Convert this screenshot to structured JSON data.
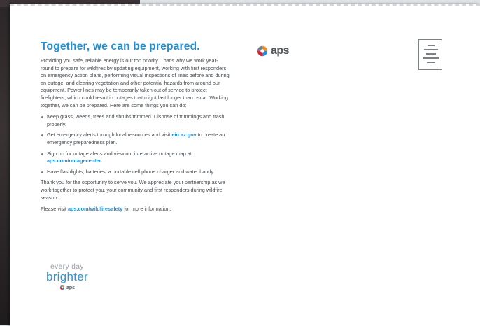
{
  "headline": "Together, we can be prepared.",
  "intro": "Providing you safe, reliable energy is our top priority. That's why we work year-round to prepare for wildfires by updating equipment, working with first responders on emergency action plans, performing visual inspections of lines before and during an outage, and clearing vegetation and other potential hazards from around our equipment. Power lines may be temporarily taken out of service to protect firefighters, which could result in outages that might last longer than usual. Working together, we can be prepared. Here are some things you can do:",
  "bullets": [
    {
      "text": "Keep grass, weeds, trees and shrubs trimmed. Dispose of trimmings and trash properly."
    },
    {
      "before": "Get emergency alerts through local resources and visit ",
      "link": "ein.az.gov",
      "after": " to create an emergency preparedness plan."
    },
    {
      "before": "Sign up for outage alerts and view our interactive outage map at ",
      "link": "aps.com/outagecenter",
      "after": "."
    },
    {
      "text": "Have flashlights, batteries, a portable cell phone charger and water handy."
    }
  ],
  "thanks": "Thank you for the opportunity to serve you. We appreciate your partnership as we work together to protect you, your community and first responders during wildfire season.",
  "visit": {
    "before": "Please visit ",
    "link": "aps.com/wildfiresafety",
    "after": " for more information."
  },
  "logo": {
    "wordmark": "aps"
  },
  "tagline": {
    "line1": "every day",
    "line2": "brighter",
    "wordmark": "aps"
  },
  "colors": {
    "accent": "#1f8fd6",
    "body_text": "#454a4f",
    "logo_gray": "#505559"
  }
}
